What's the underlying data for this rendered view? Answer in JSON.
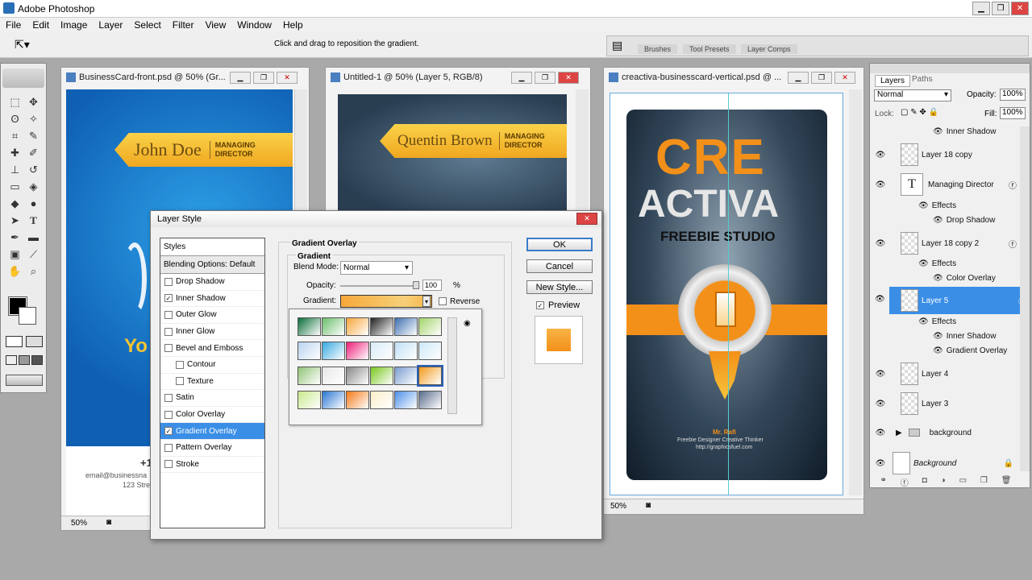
{
  "app": {
    "title": "Adobe Photoshop"
  },
  "menu": [
    "File",
    "Edit",
    "Image",
    "Layer",
    "Select",
    "Filter",
    "View",
    "Window",
    "Help"
  ],
  "options_bar": {
    "hint": "Click and drag to reposition the gradient."
  },
  "palette_well": {
    "tabs": [
      "Brushes",
      "Tool Presets",
      "Layer Comps"
    ]
  },
  "doc1": {
    "title": "BusinessCard-front.psd @ 50% (Gr...",
    "ribbon_name": "John Doe",
    "ribbon_role_1": "MANAGING",
    "ribbon_role_2": "DIRECTOR",
    "side_text": "Yo",
    "phone": "+1",
    "email": "email@businessna",
    "address": "123 Stre",
    "zoom": "50%"
  },
  "doc2": {
    "title": "Untitled-1 @ 50% (Layer 5, RGB/8)",
    "ribbon_name": "Quentin Brown",
    "ribbon_role_1": "MANAGING",
    "ribbon_role_2": "DIRECTOR"
  },
  "doc3": {
    "title": "creactiva-businesscard-vertical.psd @ ...",
    "logo_1": "CRE",
    "logo_2": "ACTIVA",
    "logo_3": "FREEBIE STUDIO",
    "person": "Mr. Rafi",
    "person_role": "Freebie Designer  Creative Thinker",
    "person_url": "http://graphicsfuel.com",
    "zoom": "50%"
  },
  "layer_style": {
    "title": "Layer Style",
    "styles_header": "Styles",
    "blending": "Blending Options: Default",
    "items": [
      {
        "label": "Drop Shadow",
        "checked": false,
        "sub": false
      },
      {
        "label": "Inner Shadow",
        "checked": true,
        "sub": false
      },
      {
        "label": "Outer Glow",
        "checked": false,
        "sub": false
      },
      {
        "label": "Inner Glow",
        "checked": false,
        "sub": false
      },
      {
        "label": "Bevel and Emboss",
        "checked": false,
        "sub": false
      },
      {
        "label": "Contour",
        "checked": false,
        "sub": true
      },
      {
        "label": "Texture",
        "checked": false,
        "sub": true
      },
      {
        "label": "Satin",
        "checked": false,
        "sub": false
      },
      {
        "label": "Color Overlay",
        "checked": false,
        "sub": false
      },
      {
        "label": "Gradient Overlay",
        "checked": true,
        "sub": false,
        "selected": true
      },
      {
        "label": "Pattern Overlay",
        "checked": false,
        "sub": false
      },
      {
        "label": "Stroke",
        "checked": false,
        "sub": false
      }
    ],
    "group_title": "Gradient Overlay",
    "group_sub": "Gradient",
    "blend_mode_label": "Blend Mode:",
    "blend_mode_value": "Normal",
    "opacity_label": "Opacity:",
    "opacity_value": "100",
    "opacity_unit": "%",
    "opacity_level": 1.0,
    "gradient_label": "Gradient:",
    "reverse_label": "Reverse",
    "ok": "OK",
    "cancel": "Cancel",
    "new_style": "New Style...",
    "preview": "Preview",
    "swatch_colors": [
      "#0c6e3a",
      "#6cbf6c",
      "#f7a63a",
      "#222222",
      "#3f6fb0",
      "#a3d36a",
      "#b9d3ef",
      "#36a8e0",
      "#ee1f7a",
      "#d8ebf7",
      "#bfe0f5",
      "#cde9f8",
      "#92c478",
      "#e8e8e8",
      "#888888",
      "#7ac81e",
      "#7a9ed0",
      "#f29b1f",
      "#c9ea8c",
      "#2a76d2",
      "#f47a17",
      "#fbeec8",
      "#4d90e8",
      "#5a6c8a"
    ]
  },
  "layers_panel": {
    "tabs": [
      "Layers",
      "Paths"
    ],
    "blend": "Normal",
    "opacity_label": "Opacity:",
    "opacity_value": "100%",
    "lock_label": "Lock:",
    "fill_label": "Fill:",
    "fill_value": "100%",
    "rows": {
      "r1": "Inner Shadow",
      "r2": "Layer 18 copy",
      "r3": "Managing Director",
      "r4": "Effects",
      "r5": "Drop Shadow",
      "r6": "Layer 18 copy 2",
      "r7": "Effects",
      "r8": "Color Overlay",
      "r9": "Layer 5",
      "r10": "Effects",
      "r11": "Inner Shadow",
      "r12": "Gradient Overlay",
      "r13": "Layer 4",
      "r14": "Layer 3",
      "r15": "background",
      "r16": "Background"
    }
  }
}
